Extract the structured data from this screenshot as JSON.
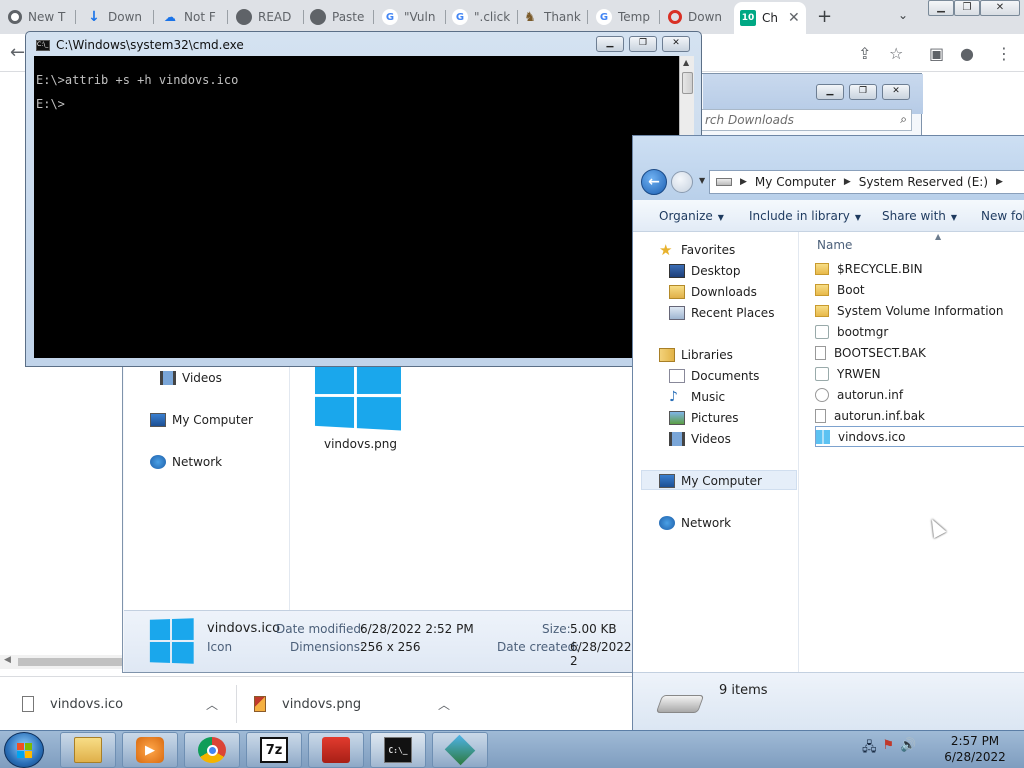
{
  "chrome": {
    "tabs": [
      {
        "label": "New T",
        "color": "#5f6368",
        "glyph": "○"
      },
      {
        "label": "Down",
        "color": "#1a73e8",
        "glyph": "↓"
      },
      {
        "label": "Not F",
        "color": "#1a73e8",
        "glyph": "☁"
      },
      {
        "label": "READ",
        "color": "#5f6368",
        "glyph": "◐"
      },
      {
        "label": "Paste",
        "color": "#5f6368",
        "glyph": "◐"
      },
      {
        "label": "\"Vuln",
        "color": "#ffffff",
        "glyph": "G"
      },
      {
        "label": "\".click",
        "color": "#ffffff",
        "glyph": "G"
      },
      {
        "label": "Thank",
        "color": "#7a5a2a",
        "glyph": "♞"
      },
      {
        "label": "Temp",
        "color": "#ffffff",
        "glyph": "G"
      },
      {
        "label": "Down",
        "color": "#d93025",
        "glyph": "⊘"
      },
      {
        "label": "Ch",
        "color": "#00a884",
        "glyph": "10"
      }
    ],
    "new_tab": "+",
    "tab_search": "⌄",
    "downloads": [
      {
        "name": "vindovs.ico"
      },
      {
        "name": "vindovs.png"
      }
    ]
  },
  "cmd": {
    "title": "C:\\Windows\\system32\\cmd.exe",
    "icon_label": "C:\\_",
    "lines": [
      "E:\\>attrib +s +h vindovs.ico",
      "E:\\>"
    ]
  },
  "explorer_back": {
    "search_placeholder": "rch Downloads",
    "nav": [
      {
        "label": "Videos"
      },
      {
        "label": "My Computer"
      },
      {
        "label": "Network"
      }
    ],
    "file_label": "vindovs.png",
    "details": {
      "name": "vindovs.ico",
      "type": "Icon",
      "modified_label": "Date modified:",
      "modified": "6/28/2022 2:52 PM",
      "dimensions_label": "Dimensions:",
      "dimensions": "256 x 256",
      "size_label": "Size:",
      "size": "5.00 KB",
      "created_label": "Date created:",
      "created": "6/28/2022 2"
    }
  },
  "explorer_front": {
    "address": [
      "My Computer",
      "System Reserved (E:)"
    ],
    "commands": [
      {
        "label": "Organize"
      },
      {
        "label": "Include in library"
      },
      {
        "label": "Share with"
      },
      {
        "label": "New fold"
      }
    ],
    "nav": {
      "favorites": "Favorites",
      "desktop": "Desktop",
      "downloads": "Downloads",
      "recent": "Recent Places",
      "libraries": "Libraries",
      "documents": "Documents",
      "music": "Music",
      "pictures": "Pictures",
      "videos": "Videos",
      "mycomputer": "My Computer",
      "network": "Network"
    },
    "column_header": "Name",
    "files": [
      {
        "name": "$RECYCLE.BIN",
        "icon": "folder"
      },
      {
        "name": "Boot",
        "icon": "folder"
      },
      {
        "name": "System Volume Information",
        "icon": "folder"
      },
      {
        "name": "bootmgr",
        "icon": "sysfile"
      },
      {
        "name": "BOOTSECT.BAK",
        "icon": "doc"
      },
      {
        "name": "YRWEN",
        "icon": "sysfile"
      },
      {
        "name": "autorun.inf",
        "icon": "gear"
      },
      {
        "name": "autorun.inf.bak",
        "icon": "doc"
      },
      {
        "name": "vindovs.ico",
        "icon": "winico"
      }
    ],
    "status": "9 items"
  },
  "taskbar": {
    "apps": [
      {
        "name": "Windows Explorer"
      },
      {
        "name": "Windows Media Player"
      },
      {
        "name": "Google Chrome"
      },
      {
        "name": "7-Zip",
        "label": "7z"
      },
      {
        "name": "Toolbox"
      },
      {
        "name": "Command Prompt",
        "label": "C:\\_"
      },
      {
        "name": "Network Tool"
      }
    ],
    "time": "2:57 PM",
    "date": "6/28/2022"
  }
}
